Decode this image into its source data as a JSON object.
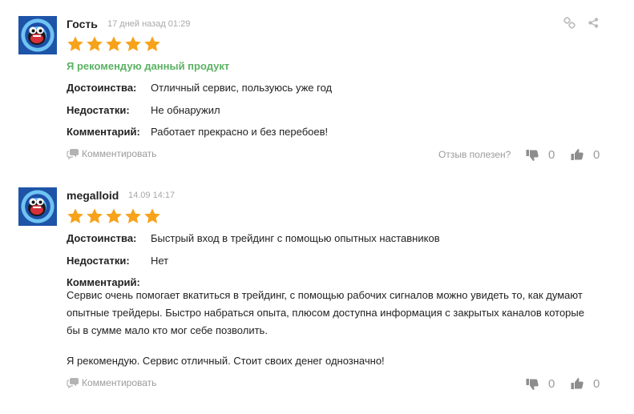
{
  "colors": {
    "accent_green": "#5bb264",
    "star": "#f7a21b",
    "muted": "#9b9b9b",
    "date": "#a8a8a8"
  },
  "reviews": [
    {
      "author": "Гость",
      "date": "17 дней назад 01:29",
      "rating": 5,
      "recommend": "Я рекомендую данный продукт",
      "pros_label": "Достоинства:",
      "pros": "Отличный сервис, пользуюсь уже год",
      "cons_label": "Недостатки:",
      "cons": "Не обнаружил",
      "comment_label": "Комментарий:",
      "comment": "Работает прекрасно и без перебоев!",
      "comment_action": "Комментировать",
      "helpful_question": "Отзыв полезен?",
      "dislikes": "0",
      "likes": "0",
      "icons": [
        "link-icon",
        "share-icon",
        "comment-bubble-icon",
        "thumbs-down-icon",
        "thumbs-up-icon"
      ]
    },
    {
      "author": "megalloid",
      "date": "14.09 14:17",
      "rating": 5,
      "pros_label": "Достоинства:",
      "pros": "Быстрый вход в трейдинг с помощью опытных наставников",
      "cons_label": "Недостатки:",
      "cons": "Нет",
      "comment_label": "Комментарий:",
      "comment_line1": "Сервис очень помогает вкатиться в трейдинг, с помощью рабочих сигналов можно увидеть то, как думают",
      "comment_line2": "опытные трейдеры. Быстро набраться опыта, плюсом доступна информация с закрытых каналов которые",
      "comment_line3": "бы в сумме мало кто мог себе позволить.",
      "comment_line4": "Я рекомендую. Сервис отличный. Стоит своих денег однозначно!",
      "comment_action": "Комментировать",
      "dislikes": "0",
      "likes": "0"
    }
  ]
}
